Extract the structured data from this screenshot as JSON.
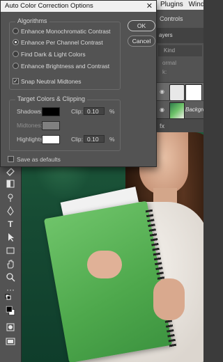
{
  "dialog": {
    "title": "Auto Color Correction Options",
    "close_glyph": "✕",
    "algorithms": {
      "title": "Algorithms",
      "options": [
        {
          "label": "Enhance Monochromatic Contrast",
          "selected": false
        },
        {
          "label": "Enhance Per Channel Contrast",
          "selected": true
        },
        {
          "label": "Find Dark & Light Colors",
          "selected": false
        },
        {
          "label": "Enhance Brightness and Contrast",
          "selected": false
        }
      ],
      "snap_neutral_midtones": {
        "label": "Snap Neutral Midtones",
        "checked": true
      }
    },
    "target": {
      "title": "Target Colors & Clipping",
      "shadows": {
        "label": "Shadows:",
        "color": "#000000",
        "clip_label": "Clip:",
        "clip_value": "0.10",
        "unit": "%"
      },
      "midtones": {
        "label": "Midtones:",
        "color": "#808080"
      },
      "highlights": {
        "label": "Highlights:",
        "color": "#ffffff",
        "clip_label": "Clip:",
        "clip_value": "0.10",
        "unit": "%"
      }
    },
    "save_defaults": {
      "label": "Save as defaults",
      "checked": false
    },
    "ok_label": "OK",
    "cancel_label": "Cancel"
  },
  "app": {
    "menu_plugins": "Plugins",
    "menu_window": "Windo",
    "options_controls": "Controls",
    "layers_tab": "ayers",
    "layers_search": "Kind",
    "layers_mode": "ormal",
    "layers_lock": "k:",
    "background_layer_name": "Background",
    "fx_label": "fx"
  }
}
